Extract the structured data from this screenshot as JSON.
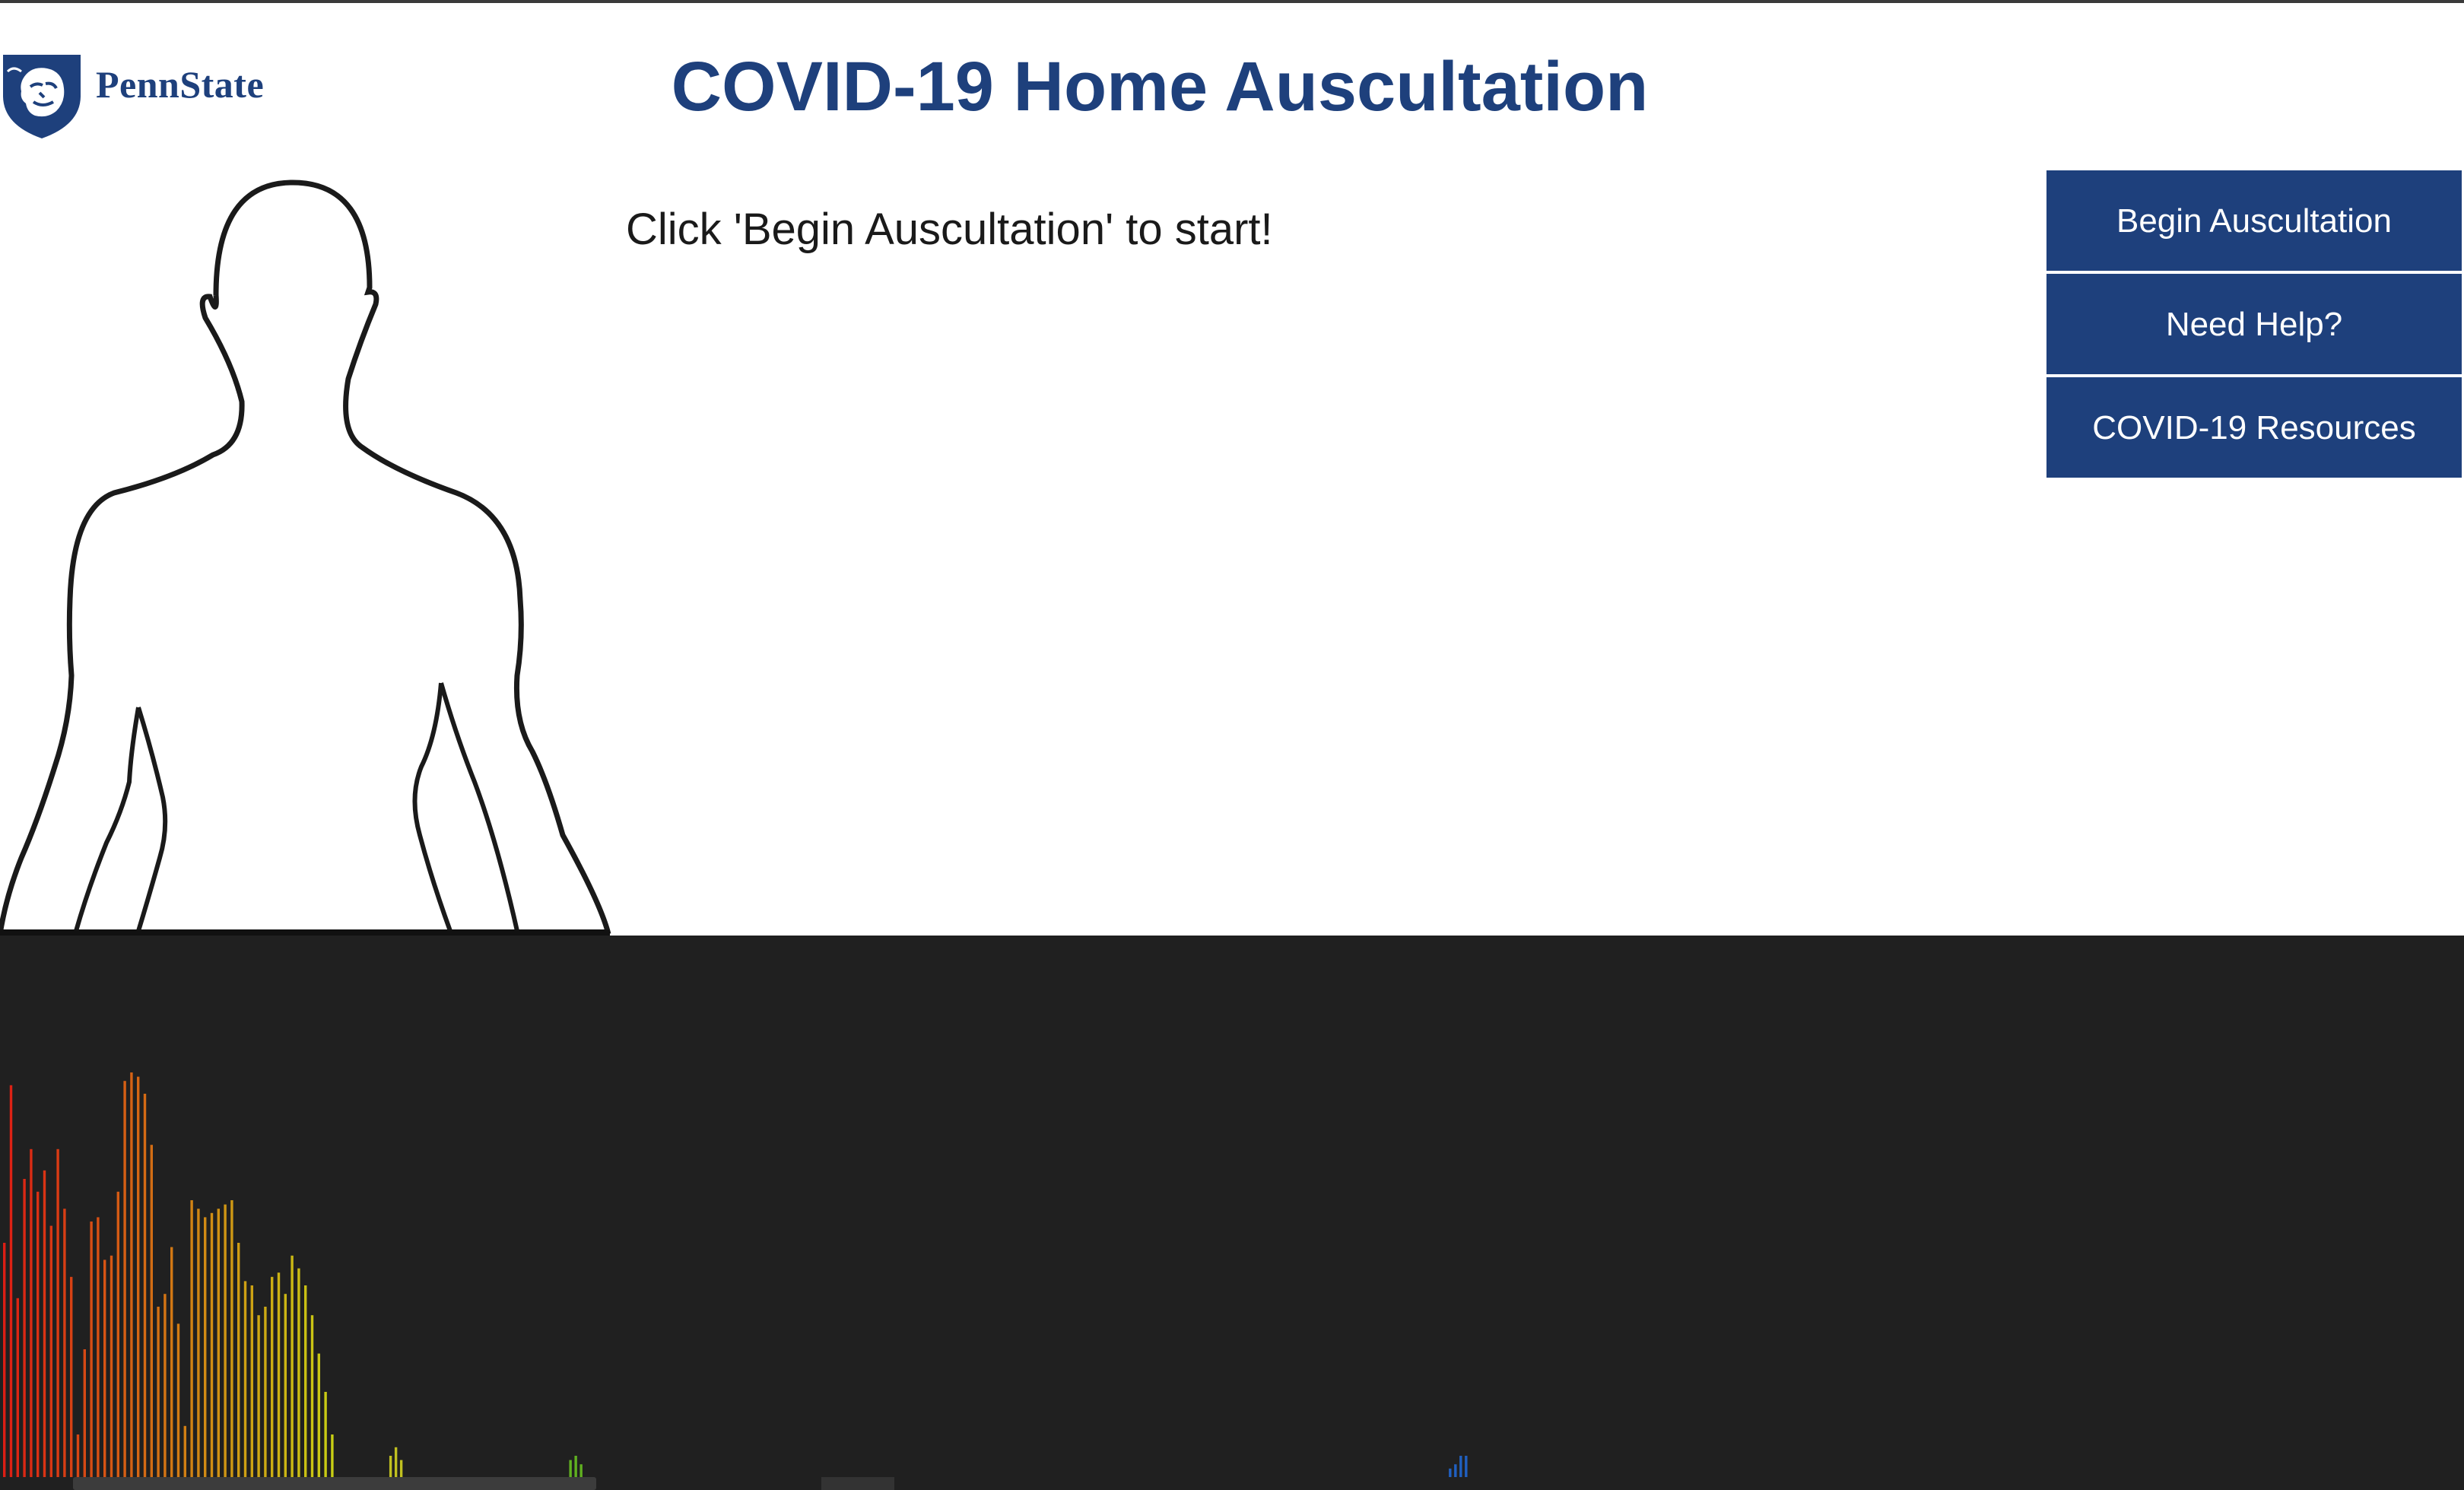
{
  "header": {
    "logo_text": "PennState",
    "title": "COVID-19 Home Auscultation"
  },
  "main": {
    "prompt": "Click 'Begin Auscultation' to start!"
  },
  "buttons": [
    {
      "label": "Begin Auscultation"
    },
    {
      "label": "Need Help?"
    },
    {
      "label": "COVID-19 Resources"
    }
  ],
  "colors": {
    "brand": "#1e407c",
    "visualizer_bg": "#202020"
  },
  "visualizer": {
    "levels": [
      0.55,
      0.92,
      0.42,
      0.7,
      0.77,
      0.67,
      0.72,
      0.59,
      0.77,
      0.63,
      0.47,
      0.1,
      0.3,
      0.6,
      0.61,
      0.51,
      0.52,
      0.67,
      0.93,
      0.95,
      0.94,
      0.9,
      0.78,
      0.4,
      0.43,
      0.54,
      0.36,
      0.12,
      0.65,
      0.63,
      0.61,
      0.62,
      0.63,
      0.64,
      0.65,
      0.55,
      0.46,
      0.45,
      0.38,
      0.4,
      0.47,
      0.48,
      0.43,
      0.52,
      0.49,
      0.45,
      0.38,
      0.29,
      0.2,
      0.1
    ],
    "small_groups": [
      {
        "start": 0.158,
        "levels": [
          0.05,
          0.07,
          0.04
        ],
        "color": "#c0c020"
      },
      {
        "start": 0.231,
        "levels": [
          0.04,
          0.05,
          0.03
        ],
        "color": "#60b020"
      },
      {
        "start": 0.588,
        "levels": [
          0.02,
          0.03,
          0.05,
          0.05
        ],
        "color": "#2060c0"
      }
    ]
  }
}
